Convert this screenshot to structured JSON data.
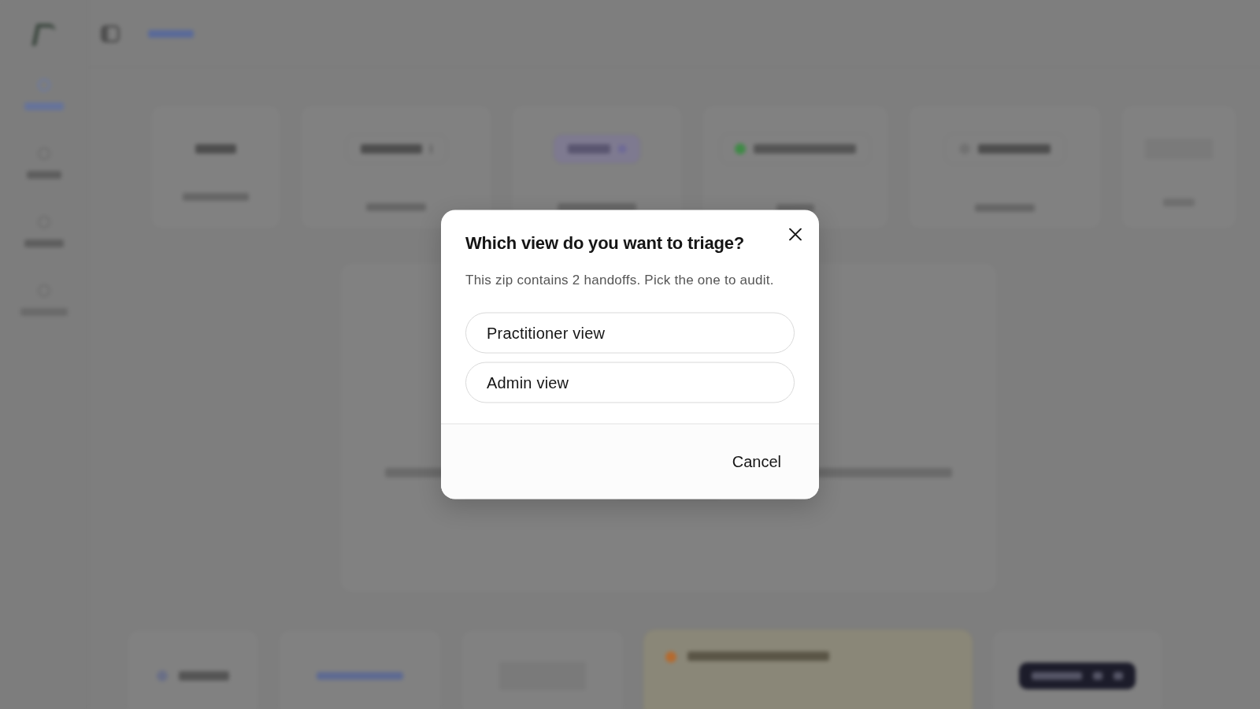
{
  "dialog": {
    "title": "Which view do you want to triage?",
    "description": "This zip contains 2 handoffs. Pick the one to audit.",
    "options": [
      {
        "label": "Practitioner view",
        "selected": false
      },
      {
        "label": "Admin view",
        "selected": false
      }
    ],
    "buttons": [
      {
        "label": "Cancel",
        "kind": "text"
      }
    ]
  }
}
